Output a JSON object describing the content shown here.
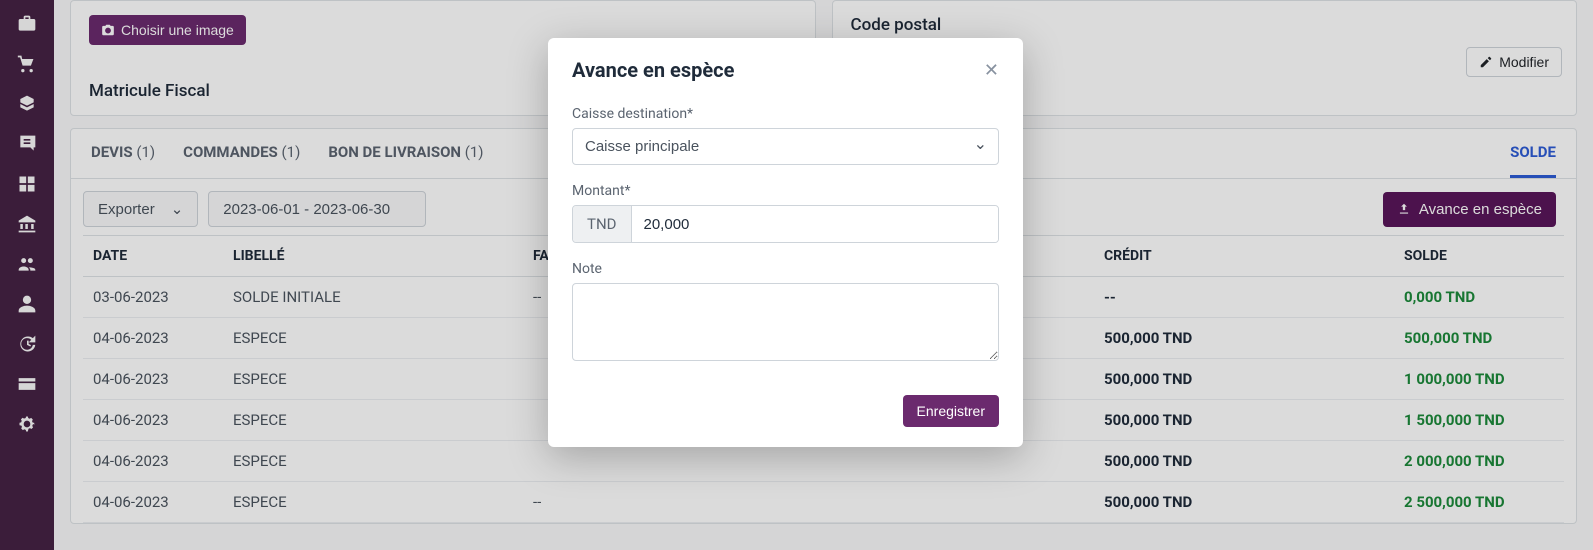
{
  "sidebar": {
    "items": [
      {
        "name": "briefcase"
      },
      {
        "name": "cart"
      },
      {
        "name": "boxes"
      },
      {
        "name": "dolly"
      },
      {
        "name": "layout"
      },
      {
        "name": "bank"
      },
      {
        "name": "users"
      },
      {
        "name": "user"
      },
      {
        "name": "history"
      },
      {
        "name": "card"
      },
      {
        "name": "settings"
      }
    ]
  },
  "top": {
    "choose_image_label": "Choisir une image",
    "matricule_label": "Matricule Fiscal",
    "code_postal_label": "Code postal",
    "modifier_label": "Modifier"
  },
  "tabs": [
    {
      "label": "DEVIS",
      "count": "(1)"
    },
    {
      "label": "COMMANDES",
      "count": "(1)"
    },
    {
      "label": "BON DE LIVRAISON",
      "count": "(1)"
    },
    {
      "label": "SOLDE",
      "count": ""
    }
  ],
  "toolbar": {
    "export_label": "Exporter",
    "date_range": "2023-06-01 - 2023-06-30",
    "avance_label": "Avance en espèce"
  },
  "table": {
    "headers": {
      "date": "DATE",
      "libelle": "LIBELLÉ",
      "facture": "FAC",
      "credit": "CRÉDIT",
      "solde": "SOLDE"
    },
    "rows": [
      {
        "date": "03-06-2023",
        "libelle": "SOLDE INITIALE",
        "facture": "--",
        "credit": "--",
        "solde": "0,000 TND"
      },
      {
        "date": "04-06-2023",
        "libelle": "ESPECE",
        "facture": "",
        "credit": "500,000 TND",
        "solde": "500,000 TND"
      },
      {
        "date": "04-06-2023",
        "libelle": "ESPECE",
        "facture": "",
        "credit": "500,000 TND",
        "solde": "1 000,000 TND"
      },
      {
        "date": "04-06-2023",
        "libelle": "ESPECE",
        "facture": "",
        "credit": "500,000 TND",
        "solde": "1 500,000 TND"
      },
      {
        "date": "04-06-2023",
        "libelle": "ESPECE",
        "facture": "",
        "credit": "500,000 TND",
        "solde": "2 000,000 TND"
      },
      {
        "date": "04-06-2023",
        "libelle": "ESPECE",
        "facture": "--",
        "credit": "500,000 TND",
        "solde": "2 500,000 TND"
      }
    ]
  },
  "modal": {
    "title": "Avance en espèce",
    "caisse_label": "Caisse destination*",
    "caisse_value": "Caisse principale",
    "montant_label": "Montant*",
    "currency": "TND",
    "montant_value": "20,000",
    "note_label": "Note",
    "note_value": "",
    "save_label": "Enregistrer"
  }
}
